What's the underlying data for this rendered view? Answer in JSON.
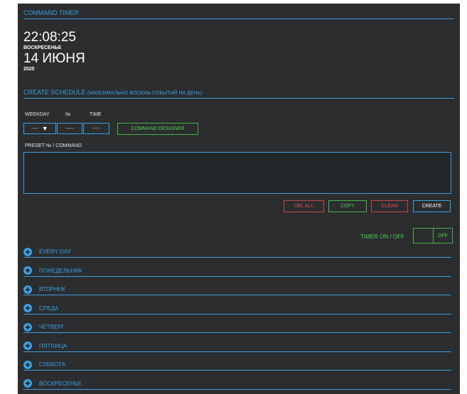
{
  "app": {
    "title": "COMMAND TIMER"
  },
  "clock": {
    "time": "22:08:25",
    "weekday": "ВОСКРЕСЕНЬЕ",
    "date": "14 ИЮНЯ",
    "year": "2020"
  },
  "schedule": {
    "title": "CREATE SCHEDULE",
    "subtitle": "(МАКСИМАЛЬНО ВОСЕМЬ СОБЫТИЙ НА ДЕНЬ)",
    "weekday_label": "WEEKDAY",
    "number_label": "№",
    "time_label": "TIME",
    "weekday_value": "----",
    "weekday_arrow": "▼",
    "number_value": "-----",
    "time_value": "--:--",
    "designer_button": "COMMAND DESIGNER",
    "command_label": "PRESET № / COMMAND",
    "command_value": ""
  },
  "actions": {
    "del_all": "DEL ALL",
    "copy": "COPY",
    "clean": "CLEAN",
    "create": "CREATE"
  },
  "timer": {
    "label": "TIMER ON / OFF",
    "state": "OFF"
  },
  "days": [
    {
      "label": "EVERY DAY"
    },
    {
      "label": "ПОНЕДЕЛЬНИК"
    },
    {
      "label": "ВТОРНИК"
    },
    {
      "label": "СРЕДА"
    },
    {
      "label": "ЧЕТВЕРГ"
    },
    {
      "label": "ПЯТНИЦА"
    },
    {
      "label": "СУББОТА"
    },
    {
      "label": "ВОСКРЕСЕНЬЕ"
    }
  ],
  "colors": {
    "background": "#2b2d2f",
    "accent_blue": "#3aa0e0",
    "green": "#4cd44c",
    "red": "#e05050"
  }
}
